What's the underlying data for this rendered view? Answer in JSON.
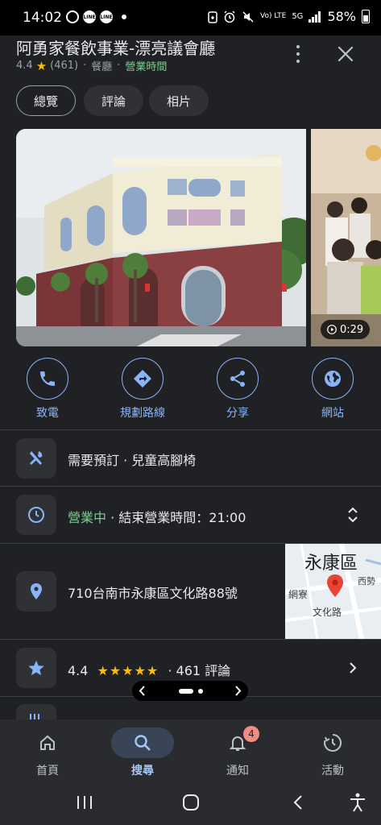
{
  "status_bar": {
    "time": "14:02",
    "left_icons": [
      "threads-icon",
      "line-icon",
      "line-icon"
    ],
    "right_icons": [
      "battery-saver-icon",
      "alarm-icon",
      "mute-icon",
      "volte-icon",
      "5g-icon",
      "signal-icon"
    ],
    "battery": "58%",
    "volte_label": "Vo) LTE",
    "net_label": "5G"
  },
  "place": {
    "name": "阿勇家餐飲事業-漂亮議會廳",
    "rating": "4.4",
    "review_count": "(461)",
    "category": "餐廳",
    "open_status": "營業時間"
  },
  "tabs": [
    {
      "label": "總覽",
      "active": true
    },
    {
      "label": "評論",
      "active": false
    },
    {
      "label": "相片",
      "active": false
    }
  ],
  "photos": {
    "video_duration": "0:29"
  },
  "actions": [
    {
      "label": "致電",
      "icon": "phone-icon"
    },
    {
      "label": "規劃路線",
      "icon": "directions-icon"
    },
    {
      "label": "分享",
      "icon": "share-icon"
    },
    {
      "label": "網站",
      "icon": "globe-icon"
    }
  ],
  "info_rows": {
    "dining": {
      "text": "需要預訂 · 兒童高腳椅",
      "icon": "cutlery-icon"
    },
    "hours": {
      "status": "營業中",
      "text": " · 結束營業時間：21:00",
      "icon": "clock-icon"
    },
    "address": {
      "text": "710台南市永康區文化路88號",
      "icon": "location-pin-icon"
    },
    "rating": {
      "value": "4.4",
      "stars": "★★★★★",
      "text": "· 461 評論",
      "icon": "star-icon"
    }
  },
  "map_thumb": {
    "district": "永康區",
    "road": "文化路",
    "area_left": "網寮",
    "area_right": "西勢"
  },
  "bottom_nav": [
    {
      "label": "首頁",
      "icon": "home-icon",
      "active": false
    },
    {
      "label": "搜尋",
      "icon": "search-icon",
      "active": true
    },
    {
      "label": "通知",
      "icon": "bell-icon",
      "active": false,
      "badge": "4"
    },
    {
      "label": "活動",
      "icon": "activity-icon",
      "active": false
    }
  ],
  "colors": {
    "accent_blue": "#8ab4f8",
    "open_green": "#81c995",
    "star_yellow": "#fbbc04",
    "background": "#202124"
  }
}
